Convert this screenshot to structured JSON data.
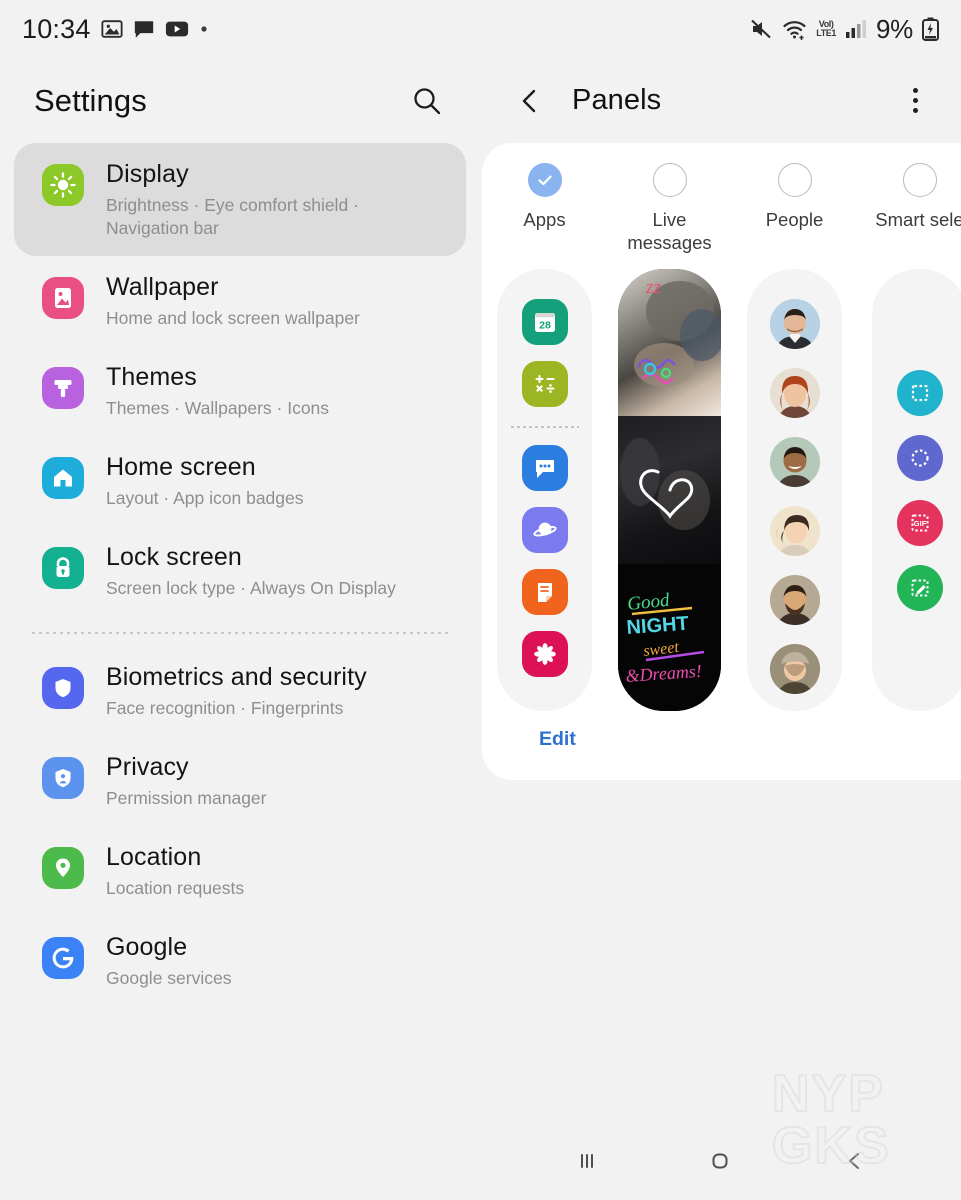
{
  "status_bar": {
    "clock": "10:34",
    "left_icons": [
      "gallery-icon",
      "message-icon",
      "youtube-icon",
      "dot-icon"
    ],
    "right_icons": [
      "mute-icon",
      "wifi-icon",
      "volte-icon",
      "signal-icon"
    ],
    "volte_label": "VoLTE1",
    "volte_line1": "VoI)",
    "volte_line2": "LTE1",
    "battery_percent": "9%"
  },
  "settings": {
    "title": "Settings",
    "search_icon": "search-icon",
    "items": [
      {
        "title": "Display",
        "subtitle": "Brightness  ·  Eye comfort shield  ·  Navigation bar",
        "icon": "brightness-sun-icon",
        "color": "#8dc829",
        "selected": true
      },
      {
        "title": "Wallpaper",
        "subtitle": "Home and lock screen wallpaper",
        "icon": "picture-icon",
        "color": "#ea4f84",
        "selected": false
      },
      {
        "title": "Themes",
        "subtitle": "Themes  ·  Wallpapers  ·  Icons",
        "icon": "paintbrush-icon",
        "color": "#b862e0",
        "selected": false
      },
      {
        "title": "Home screen",
        "subtitle": "Layout  ·  App icon badges",
        "icon": "home-icon",
        "color": "#1eaddb",
        "selected": false
      },
      {
        "title": "Lock screen",
        "subtitle": "Screen lock type  ·  Always On Display",
        "icon": "lock-icon",
        "color": "#13b092",
        "selected": false
      }
    ],
    "items_group2": [
      {
        "title": "Biometrics and security",
        "subtitle": "Face recognition  ·  Fingerprints",
        "icon": "shield-icon",
        "color": "#5667ef",
        "selected": false
      },
      {
        "title": "Privacy",
        "subtitle": "Permission manager",
        "icon": "privacy-shield-person-icon",
        "color": "#5b93ee",
        "selected": false
      },
      {
        "title": "Location",
        "subtitle": "Location requests",
        "icon": "map-pin-icon",
        "color": "#4cbb4c",
        "selected": false
      },
      {
        "title": "Google",
        "subtitle": "Google services",
        "icon": "google-g-icon",
        "color": "#3b82f6",
        "selected": false
      }
    ]
  },
  "panels": {
    "title": "Panels",
    "back_icon": "chevron-left-icon",
    "more_icon": "more-vertical-icon",
    "edit_label": "Edit",
    "accent_checked": "#8ab4f0",
    "tabs": [
      {
        "label": "Apps",
        "checked": true
      },
      {
        "label": "Live\nmessages",
        "checked": false
      },
      {
        "label": "People",
        "checked": false
      },
      {
        "label": "Smart sele",
        "checked": false
      }
    ],
    "apps_panel": {
      "icons_top": [
        {
          "name": "calendar-icon",
          "color": "#13a07a",
          "glyph": "28"
        },
        {
          "name": "calculator-icon",
          "color": "#9cb522",
          "glyph": "+-x÷"
        }
      ],
      "icons_bottom": [
        {
          "name": "messages-icon",
          "color": "#2b7ee0",
          "glyph": "•••"
        },
        {
          "name": "internet-icon",
          "color": "#7b7bef",
          "glyph": "saturn"
        },
        {
          "name": "notes-icon",
          "color": "#f0641e",
          "glyph": "note"
        },
        {
          "name": "gallery-flower-icon",
          "color": "#dd1155",
          "glyph": "flower"
        }
      ]
    },
    "live_messages_panel": {
      "thumbnails": [
        {
          "name": "live-message-thumb-pug",
          "caption": "zz"
        },
        {
          "name": "live-message-thumb-heart",
          "caption": "heart-doodle"
        },
        {
          "name": "live-message-thumb-goodnight",
          "caption": "Good NIGHT sweet Dreams!"
        }
      ]
    },
    "people_panel": {
      "avatars": [
        "avatar-man-suit",
        "avatar-woman-red-hair",
        "avatar-man-smiling",
        "avatar-woman-short-hair",
        "avatar-man-beard",
        "avatar-woman-hat"
      ]
    },
    "smart_select_panel": {
      "tools": [
        {
          "name": "rectangle-select-icon",
          "color": "#22b3cc"
        },
        {
          "name": "oval-select-icon",
          "color": "#5f68cf"
        },
        {
          "name": "gif-select-icon",
          "color": "#e4335c",
          "glyph": "GIF"
        },
        {
          "name": "pin-write-icon",
          "color": "#22b457"
        }
      ]
    }
  },
  "navigation_bar": {
    "recents_icon": "recents-icon",
    "home_icon": "home-circle-icon",
    "back_icon": "back-chevron-icon"
  },
  "watermark": {
    "line1": "NYP",
    "line2": "GKS"
  }
}
